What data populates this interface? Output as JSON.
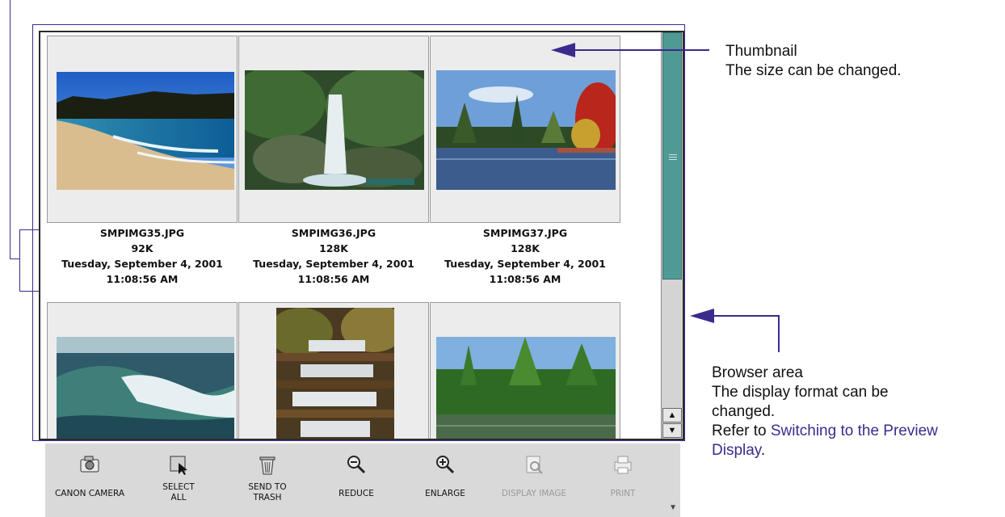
{
  "thumbnails": [
    {
      "filename": "SMPIMG35.JPG",
      "size": "92K",
      "date": "Tuesday, September 4, 2001",
      "time": "11:08:56 AM",
      "subject": "beach"
    },
    {
      "filename": "SMPIMG36.JPG",
      "size": "128K",
      "date": "Tuesday, September 4, 2001",
      "time": "11:08:56 AM",
      "subject": "waterfall"
    },
    {
      "filename": "SMPIMG37.JPG",
      "size": "128K",
      "date": "Tuesday, September 4, 2001",
      "time": "11:08:56 AM",
      "subject": "lake-autumn"
    },
    {
      "subject": "wave"
    },
    {
      "subject": "cascade"
    },
    {
      "subject": "palm-lagoon"
    }
  ],
  "toolbar": {
    "canon_camera": "CANON CAMERA",
    "select_all": "SELECT\nALL",
    "send_to_trash": "SEND TO\nTRASH",
    "reduce": "REDUCE",
    "enlarge": "ENLARGE",
    "display_image": "DISPLAY IMAGE",
    "print": "PRINT"
  },
  "icons": {
    "canon_camera": "camera-icon",
    "select_all": "cursor-icon",
    "send_to_trash": "trash-icon",
    "reduce": "zoom-out-icon",
    "enlarge": "zoom-in-icon",
    "display_image": "magnify-document-icon",
    "print": "printer-icon",
    "scroll_up": "up-arrow-icon",
    "scroll_down": "down-arrow-icon",
    "more": "chevron-down-icon"
  },
  "scrollbar": {
    "position": 0.6
  },
  "annotations": {
    "thumbnail_title": "Thumbnail",
    "thumbnail_desc": "The size can be changed.",
    "browser_title": "Browser area",
    "browser_desc_1": "The display format can be",
    "browser_desc_2": "changed.",
    "refer_prefix": "Refer to ",
    "refer_link_1": "Switching to the Preview",
    "refer_link_2": "Display",
    "refer_suffix": "."
  },
  "colors": {
    "callout": "#3c2a8c",
    "scroll_thumb": "#4f9a95",
    "toolbar_bg": "#d9d9d9"
  }
}
